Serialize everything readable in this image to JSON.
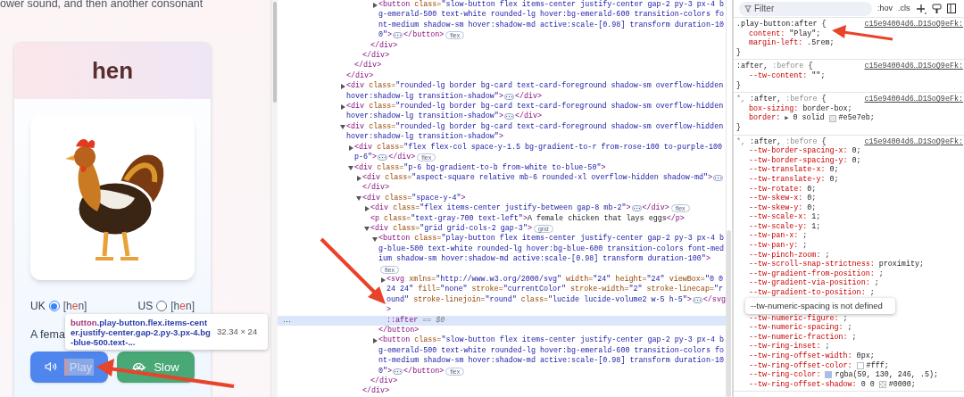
{
  "page": {
    "intro_text": "ower sound, and then another consonant",
    "card": {
      "word": "hen",
      "pronunciations": [
        {
          "region": "UK",
          "selected": true,
          "ipa": [
            {
              "t": "[h",
              "stress": false
            },
            {
              "t": "e",
              "stress": true
            },
            {
              "t": "n]",
              "stress": false
            }
          ]
        },
        {
          "region": "US",
          "selected": false,
          "ipa": [
            {
              "t": "[h",
              "stress": false
            },
            {
              "t": "e",
              "stress": true
            },
            {
              "t": "n]",
              "stress": false
            }
          ]
        }
      ],
      "definition": "A fema",
      "buttons": [
        {
          "kind": "play",
          "label": "Play",
          "highlighted": true
        },
        {
          "kind": "slow",
          "label": "Slow",
          "highlighted": false
        }
      ]
    },
    "inspect_tooltip": {
      "tag": "button",
      "classes": ".play-button.flex.items-center.justify-center.gap-2.py-3.px-4.bg-blue-500.text-...",
      "size": "32.34 × 24"
    }
  },
  "dom_tree": [
    {
      "kind": "element",
      "close": "</div>",
      "children": [
        {
          "kind": "element",
          "close": "</div>",
          "children": [
            {
              "kind": "element",
              "close": "</div>",
              "children": [
                {
                  "kind": "element",
                  "close": "</div>",
                  "children": [
                    {
                      "kind": "element",
                      "expanded": false,
                      "badge": "flex",
                      "close": "</button>",
                      "open": {
                        "tag": "<button",
                        "attrs": [
                          {
                            "name": " class=",
                            "value": "\"slow-button flex items-center justify-center gap-2 py-3 px-4 bg-emerald-500 text-white rounded-lg hover:bg-emerald-600 transition-colors font-medium shadow-sm hover:shadow-md active:scale-[0.98] transform duration-100\""
                          }
                        ],
                        "end": ">"
                      }
                    }
                  ]
                }
              ]
            }
          ]
        }
      ]
    },
    {
      "kind": "element",
      "expanded": false,
      "close": "</div>",
      "open": {
        "tag": "<div",
        "attrs": [
          {
            "name": " class=",
            "value": "\"rounded-lg border bg-card text-card-foreground shadow-sm overflow-hidden hover:shadow-lg transition-shadow\""
          }
        ],
        "end": ">"
      }
    },
    {
      "kind": "element",
      "expanded": false,
      "close": "</div>",
      "open": {
        "tag": "<div",
        "attrs": [
          {
            "name": " class=",
            "value": "\"rounded-lg border bg-card text-card-foreground shadow-sm overflow-hidden hover:shadow-lg transition-shadow\""
          }
        ],
        "end": ">"
      }
    },
    {
      "kind": "element",
      "expanded": true,
      "open": {
        "tag": "<div",
        "attrs": [
          {
            "name": " class=",
            "value": "\"rounded-lg border bg-card text-card-foreground shadow-sm overflow-hidden hover:shadow-lg transition-shadow\""
          }
        ],
        "end": ">"
      },
      "children": [
        {
          "kind": "element",
          "expanded": false,
          "badge": "flex",
          "close": "</div>",
          "open": {
            "tag": "<div",
            "attrs": [
              {
                "name": " class=",
                "value": "\"flex flex-col space-y-1.5 bg-gradient-to-r from-rose-100 to-purple-100 p-6\""
              }
            ],
            "end": ">"
          }
        },
        {
          "kind": "element",
          "expanded": true,
          "open": {
            "tag": "<div",
            "attrs": [
              {
                "name": " class=",
                "value": "\"p-6 bg-gradient-to-b from-white to-blue-50\""
              }
            ],
            "end": ">"
          },
          "children": [
            {
              "kind": "element",
              "expanded": false,
              "close": "</div>",
              "open": {
                "tag": "<div",
                "attrs": [
                  {
                    "name": " class=",
                    "value": "\"aspect-square relative mb-6 rounded-xl overflow-hidden shadow-md\""
                  }
                ],
                "end": ">"
              }
            },
            {
              "kind": "element",
              "expanded": true,
              "close": "</div>",
              "open": {
                "tag": "<div",
                "attrs": [
                  {
                    "name": " class=",
                    "value": "\"space-y-4\""
                  }
                ],
                "end": ">"
              },
              "children": [
                {
                  "kind": "element",
                  "expanded": false,
                  "badge": "flex",
                  "close": "</div>",
                  "open": {
                    "tag": "<div",
                    "attrs": [
                      {
                        "name": " class=",
                        "value": "\"flex items-center justify-between gap-8 mb-2\""
                      }
                    ],
                    "end": ">"
                  }
                },
                {
                  "kind": "text_element",
                  "text": "A female chicken that lays eggs",
                  "close": "</p>",
                  "open": {
                    "tag": "<p",
                    "attrs": [
                      {
                        "name": " class=",
                        "value": "\"text-gray-700 text-left\""
                      }
                    ],
                    "end": ">"
                  }
                },
                {
                  "kind": "element",
                  "expanded": true,
                  "badge": "grid",
                  "close": "</div>",
                  "open": {
                    "tag": "<div",
                    "attrs": [
                      {
                        "name": " class=",
                        "value": "\"grid grid-cols-2 gap-3\""
                      }
                    ],
                    "end": ">"
                  },
                  "children": [
                    {
                      "kind": "element",
                      "expanded": true,
                      "badge": "flex",
                      "close": "</button>",
                      "open": {
                        "tag": "<button",
                        "attrs": [
                          {
                            "name": " class=",
                            "value": "\"play-button flex items-center justify-center gap-2 py-3 px-4 bg-blue-500 text-white rounded-lg hover:bg-blue-600 transition-colors font-medium shadow-sm hover:shadow-md active:scale-[0.98] transform duration-100\""
                          }
                        ],
                        "end": ">"
                      },
                      "children": [
                        {
                          "kind": "element",
                          "expanded": false,
                          "close": "</svg>",
                          "open": {
                            "tag": "<svg",
                            "attrs": [
                              {
                                "name": " xmlns=",
                                "value": "\"http://www.w3.org/2000/svg\""
                              },
                              {
                                "name": " width=",
                                "value": "\"24\""
                              },
                              {
                                "name": " height=",
                                "value": "\"24\""
                              },
                              {
                                "name": " viewBox=",
                                "value": "\"0 0 24 24\""
                              },
                              {
                                "name": " fill=",
                                "value": "\"none\""
                              },
                              {
                                "name": " stroke=",
                                "value": "\"currentColor\""
                              },
                              {
                                "name": " stroke-width=",
                                "value": "\"2\""
                              },
                              {
                                "name": " stroke-linecap=",
                                "value": "\"round\""
                              },
                              {
                                "name": " stroke-linejoin=",
                                "value": "\"round\""
                              },
                              {
                                "name": " class=",
                                "value": "\"lucide lucide-volume2 w-5 h-5\""
                              }
                            ],
                            "end": ">"
                          }
                        },
                        {
                          "kind": "pseudo",
                          "text": "::after",
                          "ref": "== $0",
                          "selected": true
                        }
                      ]
                    },
                    {
                      "kind": "element",
                      "expanded": false,
                      "badge": "flex",
                      "close": "</button>",
                      "open": {
                        "tag": "<button",
                        "attrs": [
                          {
                            "name": " class=",
                            "value": "\"slow-button flex items-center justify-center gap-2 py-3 px-4 bg-emerald-500 text-white rounded-lg hover:bg-emerald-600 transition-colors font-medium shadow-sm hover:shadow-md active:scale-[0.98] transform duration-100\""
                          }
                        ],
                        "end": ">"
                      }
                    }
                  ]
                }
              ]
            }
          ]
        }
      ]
    }
  ],
  "styles": {
    "filter_placeholder": "Filter",
    "hov": ":hov",
    "cls": ".cls",
    "rules": [
      {
        "selector": [
          {
            "t": ".play-button:after",
            "matched": true
          },
          {
            "t": " {",
            "matched": true
          }
        ],
        "source": "c15e94004d6…D1SoQ9eFk:",
        "close": "}",
        "items": [
          {
            "kind": "decl",
            "prop": "content:",
            "value": "\"Play\";"
          },
          {
            "kind": "decl",
            "prop": "margin-left:",
            "value": ".5rem;"
          }
        ]
      },
      {
        "selector": [
          {
            "t": ":after,",
            "matched": true
          },
          {
            "t": " :before",
            "matched": false
          },
          {
            "t": " {",
            "matched": true
          }
        ],
        "source": "c15e94004d6…D1SoQ9eFk:",
        "close": "}",
        "items": [
          {
            "kind": "decl",
            "prop": "--tw-content:",
            "value": "\"\";"
          }
        ]
      },
      {
        "selector": [
          {
            "t": "*,",
            "matched": false
          },
          {
            "t": " :after,",
            "matched": true
          },
          {
            "t": " :before",
            "matched": false
          },
          {
            "t": " {",
            "matched": true
          }
        ],
        "source": "c15e94004d6…D1SoQ9eFk:",
        "close": "}",
        "items": [
          {
            "kind": "decl",
            "prop": "box-sizing:",
            "value": "border-box;"
          },
          {
            "kind": "decl",
            "prop": "border:",
            "expander": "▶",
            "value": "0 solid",
            "swatch": {
              "kind": "color",
              "color": "#e5e7eb"
            },
            "after": "#e5e7eb;"
          }
        ]
      },
      {
        "selector": [
          {
            "t": "*,",
            "matched": false
          },
          {
            "t": " :after,",
            "matched": true
          },
          {
            "t": " :before",
            "matched": false
          },
          {
            "t": " {",
            "matched": true
          }
        ],
        "source": "c15e94004d6…D1SoQ9eFk:",
        "items": [
          {
            "kind": "decl",
            "prop": "--tw-border-spacing-x:",
            "value": "0;"
          },
          {
            "kind": "decl",
            "prop": "--tw-border-spacing-y:",
            "value": "0;"
          },
          {
            "kind": "decl",
            "prop": "--tw-translate-x:",
            "value": "0;"
          },
          {
            "kind": "decl",
            "prop": "--tw-translate-y:",
            "value": "0;"
          },
          {
            "kind": "decl",
            "prop": "--tw-rotate:",
            "value": "0;"
          },
          {
            "kind": "decl",
            "prop": "--tw-skew-x:",
            "value": "0;"
          },
          {
            "kind": "decl",
            "prop": "--tw-skew-y:",
            "value": "0;"
          },
          {
            "kind": "decl",
            "prop": "--tw-scale-x:",
            "value": "1;"
          },
          {
            "kind": "decl",
            "prop": "--tw-scale-y:",
            "value": "1;"
          },
          {
            "kind": "decl",
            "prop": "--tw-pan-x:",
            "value": ";"
          },
          {
            "kind": "decl",
            "prop": "--tw-pan-y:",
            "value": ";"
          },
          {
            "kind": "decl",
            "prop": "--tw-pinch-zoom:",
            "value": ";"
          },
          {
            "kind": "decl",
            "prop": "--tw-scroll-snap-strictness:",
            "value": "proximity;"
          },
          {
            "kind": "decl",
            "prop": "--tw-gradient-from-position:",
            "value": ";"
          },
          {
            "kind": "decl",
            "prop": "--tw-gradient-via-position:",
            "value": ";"
          },
          {
            "kind": "decl",
            "prop": "--tw-gradient-to-position:",
            "value": ";"
          },
          {
            "kind": "tooltip",
            "text": "--tw-numeric-spacing is not defined"
          },
          {
            "kind": "decl",
            "prop": "--tw-numeric-figure:",
            "value": ";"
          },
          {
            "kind": "decl",
            "prop": "--tw-numeric-spacing:",
            "value": ";"
          },
          {
            "kind": "decl",
            "prop": "--tw-numeric-fraction:",
            "value": ";"
          },
          {
            "kind": "decl",
            "prop": "--tw-ring-inset:",
            "value": ";"
          },
          {
            "kind": "decl",
            "prop": "--tw-ring-offset-width:",
            "value": "0px;"
          },
          {
            "kind": "decl",
            "prop": "--tw-ring-offset-color:",
            "swatch": {
              "kind": "color",
              "color": "#ffffff"
            },
            "after": "#fff;"
          },
          {
            "kind": "decl",
            "prop": "--tw-ring-color:",
            "swatch": {
              "kind": "color",
              "color": "#9dc0fa"
            },
            "after": "rgba(59, 130, 246, .5);"
          },
          {
            "kind": "decl",
            "prop": "--tw-ring-offset-shadow:",
            "value": "0 0",
            "swatch": {
              "kind": "transparent"
            },
            "after": "#0000;"
          }
        ]
      }
    ]
  }
}
